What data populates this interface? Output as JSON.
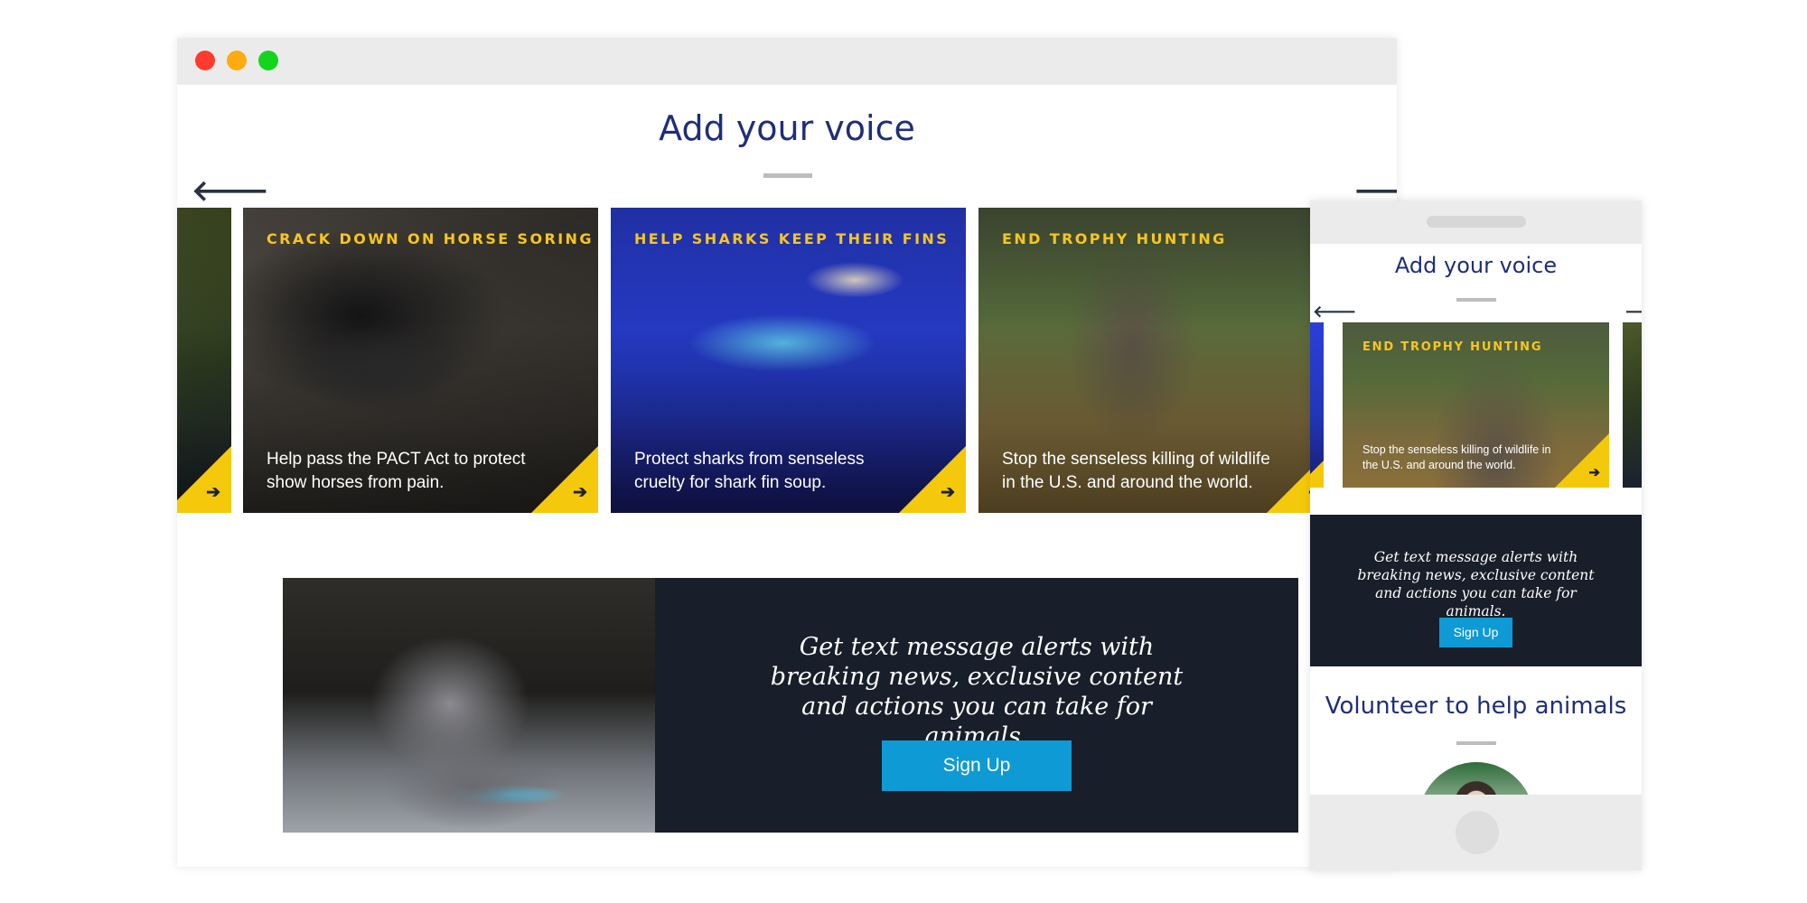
{
  "desktop": {
    "section_title": "Add your voice",
    "prev_arrow": "🡐",
    "next_arrow": "🡒",
    "cards": [
      {
        "eyebrow": "",
        "description": ""
      },
      {
        "eyebrow": "CRACK DOWN ON HORSE SORING",
        "description": "Help pass the PACT Act to protect show horses from pain."
      },
      {
        "eyebrow": "HELP SHARKS KEEP THEIR FINS",
        "description": "Protect sharks from senseless cruelty for shark fin soup."
      },
      {
        "eyebrow": "END TROPHY HUNTING",
        "description": "Stop the senseless killing of wildlife in the U.S. and around the world."
      }
    ],
    "card_arrow": "➔",
    "promo": {
      "text": "Get text message alerts with breaking news, exclusive content and actions you can take for animals.",
      "button": "Sign Up"
    }
  },
  "mobile": {
    "section_title": "Add your voice",
    "prev_arrow": "🡐",
    "next_arrow": "🡒",
    "card": {
      "eyebrow": "END TROPHY HUNTING",
      "description": "Stop the senseless killing of wildlife in the U.S. and around the world."
    },
    "card_arrow": "➔",
    "promo": {
      "text": "Get text message alerts with breaking news, exclusive content and actions you can take for animals.",
      "button": "Sign Up"
    },
    "second_title": "Volunteer to help animals"
  },
  "colors": {
    "title_blue": "#1f2e79",
    "accent_yellow": "#f5c90b",
    "button_blue": "#0e9ad4",
    "promo_bg": "#181e2a"
  }
}
